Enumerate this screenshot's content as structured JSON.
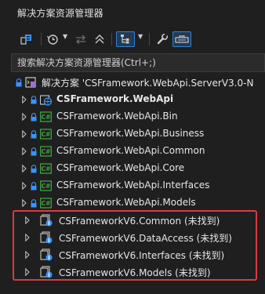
{
  "panel": {
    "title": "解决方案资源管理器"
  },
  "toolbar": {
    "icons": [
      "solution-icon",
      "history-icon",
      "dropdown",
      "swap-icon",
      "collapse-icon",
      "show-files-icon",
      "dropdown",
      "wrench-icon",
      "preview-icon"
    ]
  },
  "search": {
    "placeholder": "搜索解决方案资源管理器(Ctrl+;)"
  },
  "tree": {
    "solution": {
      "label": "解决方案 'CSFramework.WebApi.ServerV3.0-N"
    },
    "startup_project": {
      "label": "CSFramework.WebApi"
    },
    "projects": [
      {
        "label": "CSFramework.WebApi.Bin"
      },
      {
        "label": "CSFramework.WebApi.Business"
      },
      {
        "label": "CSFramework.WebApi.Common"
      },
      {
        "label": "CSFramework.WebApi.Core"
      },
      {
        "label": "CSFramework.WebApi.Interfaces"
      },
      {
        "label": "CSFramework.WebApi.Models"
      }
    ],
    "missing_projects": [
      {
        "label": "CSFrameworkV6.Common (未找到)"
      },
      {
        "label": "CSFrameworkV6.DataAccess (未找到)"
      },
      {
        "label": "CSFrameworkV6.Interfaces (未找到)"
      },
      {
        "label": "CSFrameworkV6.Models (未找到)"
      }
    ]
  },
  "colors": {
    "background": "#1f1f1f",
    "highlight_border": "#e0383e",
    "csharp_icon": "#3fa33f",
    "accent_blue": "#3794ff"
  }
}
